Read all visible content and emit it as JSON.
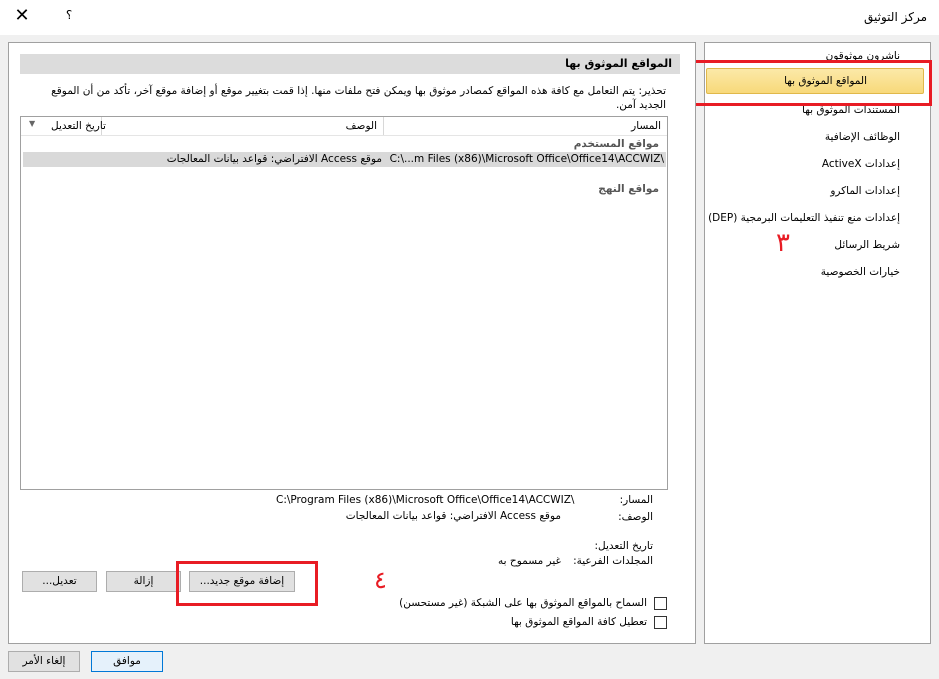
{
  "window": {
    "title": "مركز التوثيق",
    "help_label": "؟",
    "close_label": "✕"
  },
  "sidebar": {
    "items": [
      {
        "label": "ناشرون موثوقون"
      },
      {
        "label": "المواقع الموثوق بها"
      },
      {
        "label": "المستندات الموثوق بها"
      },
      {
        "label": "الوظائف الإضافية"
      },
      {
        "label": "إعدادات ActiveX"
      },
      {
        "label": "إعدادات الماكرو"
      },
      {
        "label": "إعدادات منع تنفيذ التعليمات البرمجية (DEP)"
      },
      {
        "label": "شريط الرسائل"
      },
      {
        "label": "خيارات الخصوصية"
      }
    ],
    "selected_index": 1
  },
  "annotations": {
    "sidebar_number": "٣",
    "add_button_number": "٤"
  },
  "main": {
    "section_title": "المواقع الموثوق بها",
    "warning_line1": "تحذير: يتم التعامل مع كافة هذه المواقع كمصادر موثوق بها ويمكن فتح ملفات منها. إذا قمت بتغيير موقع أو إضافة موقع آخر، تأكد من أن الموقع",
    "warning_line2": "الجديد آمن.",
    "list": {
      "col_path": "المسار",
      "col_description": "الوصف",
      "col_date": "تاريخ التعديل",
      "group_user": "مواقع المستخدم",
      "group_policy": "مواقع النهج",
      "rows": [
        {
          "path": "C:\\...m Files (x86)\\Microsoft Office\\Office14\\ACCWIZ\\",
          "description": "موقع Access الافتراضي: قواعد بيانات المعالجات",
          "date": ""
        }
      ]
    },
    "details": {
      "path_label": "المسار:",
      "path_value": "C:\\Program Files (x86)\\Microsoft Office\\Office14\\ACCWIZ\\",
      "description_label": "الوصف:",
      "description_value": "موقع Access الافتراضي: قواعد بيانات المعالجات",
      "date_label": "تاريخ التعديل:",
      "subfolders_label": "المجلدات الفرعية:",
      "subfolders_value": "غير مسموح به"
    },
    "buttons": {
      "add_new": "إضافة موقع جديد...",
      "remove": "إزالة",
      "modify": "تعديل..."
    },
    "checkboxes": {
      "allow_network": "السماح بالمواقع الموثوق بها على الشبكة (غير مستحسن)",
      "allow_network_checked": false,
      "disable_all": "تعطيل كافة المواقع الموثوق بها",
      "disable_all_checked": false
    }
  },
  "footer": {
    "ok_label": "موافق",
    "cancel_label": "إلغاء الأمر"
  }
}
